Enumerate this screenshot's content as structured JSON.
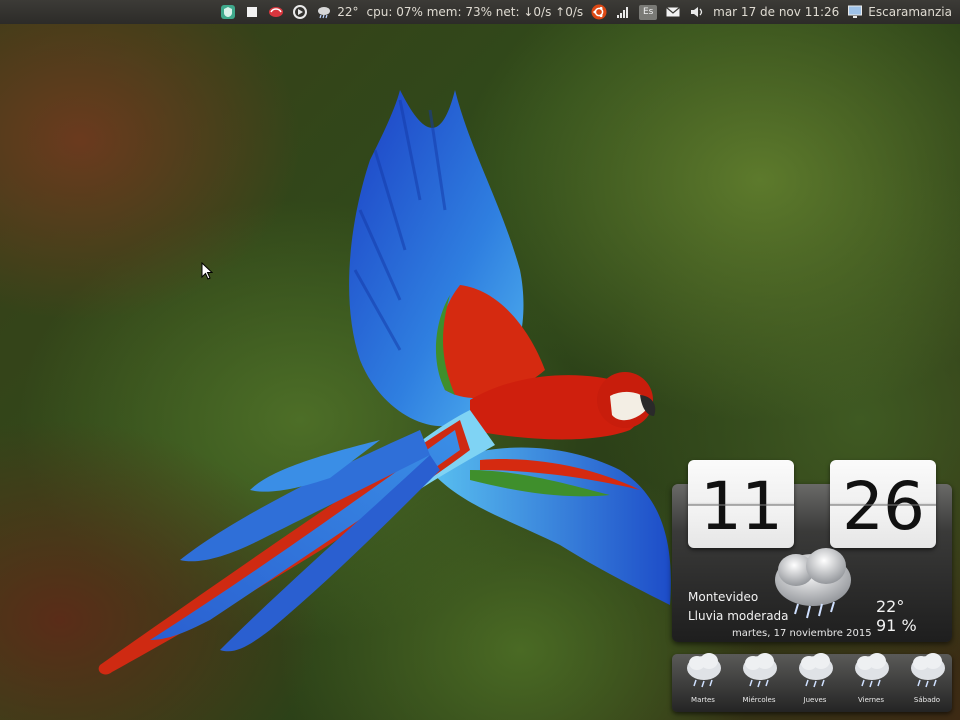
{
  "top_panel": {
    "weather": "22°",
    "sysmon": "cpu: 07% mem: 73% net: ↓0/s ↑0/s",
    "datetime": "mar 17 de nov 11:26",
    "user": "Escaramanzia",
    "keyboard_layout": "Es"
  },
  "clock": {
    "hours": "11",
    "minutes": "26"
  },
  "weather": {
    "city": "Montevideo",
    "condition": "Lluvia moderada",
    "date": "martes, 17 noviembre 2015",
    "temperature": "22°",
    "humidity": "91 %"
  },
  "forecast": {
    "days": [
      {
        "label": "Martes"
      },
      {
        "label": "Miércoles"
      },
      {
        "label": "Jueves"
      },
      {
        "label": "Viernes"
      },
      {
        "label": "Sábado"
      }
    ]
  },
  "colors": {
    "panel_bg": "#3c3b37",
    "ubuntu_orange": "#dd4814",
    "macaw_red": "#d4200e",
    "macaw_blue": "#2a6fd6"
  }
}
